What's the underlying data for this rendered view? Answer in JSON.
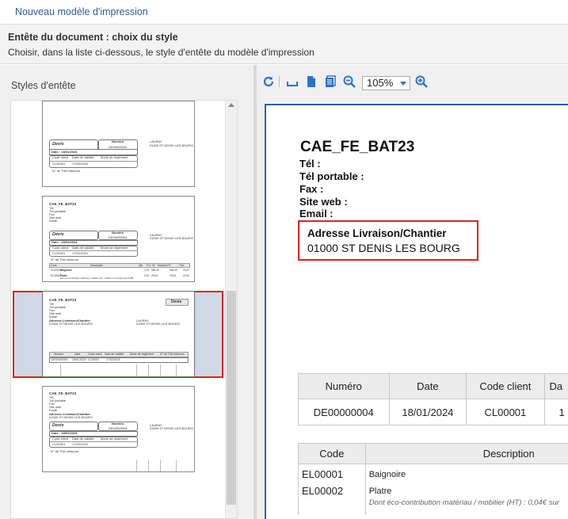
{
  "window": {
    "title": "Nouveau modèle d'impression"
  },
  "header": {
    "title": "Entête du document : choix du style",
    "subtitle": "Choisir, dans la liste ci-dessous, le style d'entête du modèle d'impression"
  },
  "styles_panel": {
    "label": "Styles d'entête",
    "thumbnails": [
      {
        "doc_type": "Devis",
        "number_label": "Numéro",
        "number": "DE00000004",
        "client_name": "LAURAY",
        "client_addr": "01000 ST DENIS LES BOURG",
        "date": "Date : 18/01/2024",
        "cols": [
          "Code client",
          "Date de validité",
          "Mode de règlement"
        ],
        "vals": [
          "CL00001",
          "17/02/2024",
          ""
        ],
        "tva": "N° de TVA Intracom"
      },
      {
        "company": "CAE_FE_BAT23",
        "fields": [
          "Tél",
          "Tél portable",
          "Fax",
          "Site web",
          "Email"
        ],
        "doc_type": "Devis",
        "number_label": "Numéro",
        "number": "DE00000004",
        "client_name": "LAURAY",
        "client_addr": "01000 ST DENIS LES BOURG",
        "date": "Date : 18/01/2024",
        "cols": [
          "Code client",
          "Date de validité",
          "Mode de règlement"
        ],
        "vals": [
          "CL00001",
          "17/02/2024",
          ""
        ],
        "tva": "N° de TVA Intracom",
        "lines_header": [
          "Code",
          "Description",
          "Qté",
          "P.U. HT",
          "Montant HT",
          "TVA"
        ],
        "line1": [
          "EL00001",
          "Baignoire",
          "1,00",
          "950,00",
          "950,00",
          "20,00"
        ],
        "line2": [
          "EL00002",
          "Platre",
          "3,00",
          "25,00",
          "75,00",
          "20,00"
        ],
        "line2_note": "Dont éco-contribution matériaux / mobilier (HT) : 0,04€ sur le montant de 25,00€"
      },
      {
        "company": "CAE_FE_BAT23",
        "fields": [
          "Tél",
          "Tél portable",
          "Fax",
          "Site web",
          "Email"
        ],
        "doc_type": "Devis",
        "delivery_label": "Adresse Livraison/Chantier",
        "delivery_addr": "01000 ST DENIS LES BOURG",
        "client_name": "LAURAY",
        "client_addr": "01000 ST DENIS LES BOURG",
        "cols": [
          "Numéro",
          "Date",
          "Code client",
          "Date de validité",
          "Mode de règlement",
          "N° de TVA Intracom"
        ],
        "vals": [
          "DE00000004",
          "18/01/2024",
          "CL00001",
          "17/02/2024",
          "",
          ""
        ]
      },
      {
        "company": "CAE_FE_BAT23",
        "fields": [
          "Tél",
          "Tél portable",
          "Fax",
          "Site web",
          "Email"
        ],
        "delivery_label": "Adresse Livraison/Chantier",
        "delivery_addr": "01000 ST DENIS LES BOURG",
        "doc_type": "Devis",
        "number_label": "Numéro",
        "number": "DE00000004",
        "client_name": "LAURAY",
        "client_addr": "01000 ST DENIS LES BOURG",
        "date": "Date : 18/01/2024",
        "cols": [
          "Code client",
          "Date de validité",
          "Mode de règlement"
        ],
        "vals": [
          "CL00001",
          "17/02/2024",
          ""
        ],
        "tva": "N° de TVA Intracom"
      }
    ]
  },
  "toolbar": {
    "icons": [
      "refresh-icon",
      "page-width-icon",
      "single-page-icon",
      "multi-page-icon",
      "zoom-out-icon",
      "zoom-in-icon"
    ],
    "zoom_value": "105%",
    "accent": "#2a73c9"
  },
  "preview": {
    "company": "CAE_FE_BAT23",
    "fields": [
      "Tél :",
      "Tél portable :",
      "Fax :",
      "Site web :",
      "Email :"
    ],
    "delivery_label": "Adresse Livraison/Chantier",
    "delivery_addr": "01000 ST DENIS LES BOURG",
    "header_table": {
      "columns": [
        "Numéro",
        "Date",
        "Code client",
        "Da"
      ],
      "values": [
        "DE00000004",
        "18/01/2024",
        "CL00001",
        "1"
      ]
    },
    "lines_table": {
      "columns": [
        "Code",
        "Description"
      ],
      "rows": [
        {
          "code": "EL00001",
          "description": "Baignoire",
          "note": ""
        },
        {
          "code": "EL00002",
          "description": "Platre",
          "note": "Dont éco-contribution matériau / mobilier (HT) : 0,04€ sur"
        }
      ]
    }
  },
  "colors": {
    "selection_border": "#e21e1e",
    "selection_bg": "#cfd9e6",
    "frame_border": "#2a5fb0",
    "highlight_box": "#d92626"
  }
}
